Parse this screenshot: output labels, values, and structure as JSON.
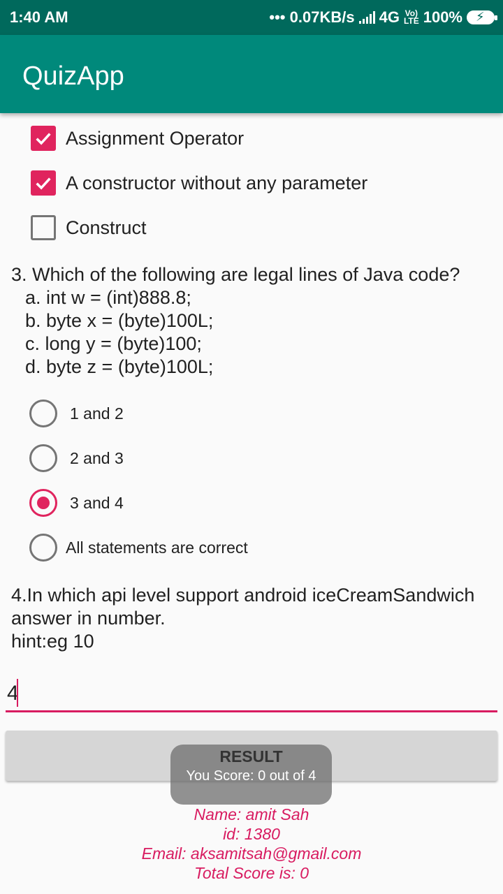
{
  "status_bar": {
    "time": "1:40 AM",
    "network_speed": "••• 0.07KB/s",
    "network_type": "4G",
    "volte": "Vo)",
    "lte": "LTE",
    "battery": "100%"
  },
  "app_bar": {
    "title": "QuizApp"
  },
  "q2_options": [
    {
      "label": "Assignment Operator",
      "checked": true
    },
    {
      "label": "A constructor without any parameter",
      "checked": true
    },
    {
      "label": "Construct",
      "checked": false
    }
  ],
  "q3": {
    "question": "3. Which of the following are legal lines of Java code?",
    "lines": [
      "a. int w = (int)888.8;",
      "b. byte x = (byte)100L;",
      "c. long y = (byte)100;",
      "d. byte z = (byte)100L;"
    ],
    "options": [
      {
        "label": "1 and 2",
        "selected": false
      },
      {
        "label": "2 and 3",
        "selected": false
      },
      {
        "label": "3 and 4",
        "selected": true
      },
      {
        "label": "All statements are correct",
        "selected": false
      }
    ]
  },
  "q4": {
    "line1": "4.In which api level support android iceCreamSandwich",
    "line2": "answer in number.",
    "line3": "hint:eg 10",
    "answer_value": "4"
  },
  "result_button": {
    "label": "RESULT"
  },
  "toast": {
    "title": "RESULT",
    "message": "You Score: 0 out of 4"
  },
  "info": {
    "name": "Name: amit Sah",
    "id": "id: 1380",
    "email": "Email: aksamitsah@gmail.com",
    "total": "Total Score is: 0"
  },
  "colors": {
    "accent": "#e0245e",
    "primary": "#00897b",
    "primary_dark": "#00695c"
  }
}
